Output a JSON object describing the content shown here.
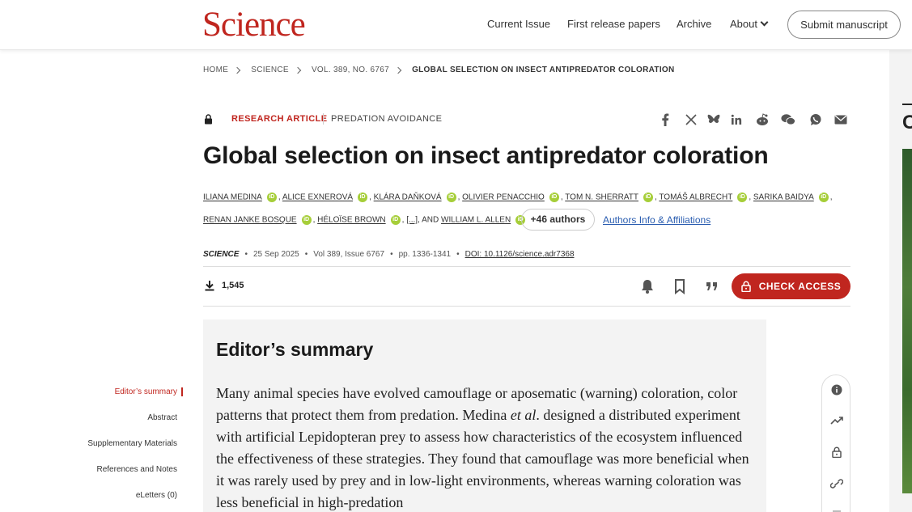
{
  "header": {
    "logo": "Science",
    "nav": {
      "current_issue": "Current Issue",
      "first_release": "First release papers",
      "archive": "Archive",
      "about": "About"
    },
    "submit_label": "Submit manuscript"
  },
  "breadcrumb": [
    "HOME",
    "SCIENCE",
    "VOL. 389, NO. 6767",
    "GLOBAL SELECTION ON INSECT ANTIPREDATOR COLORATION"
  ],
  "article": {
    "type": "RESEARCH ARTICLE",
    "subject": "PREDATION AVOIDANCE",
    "title": "Global selection on insect antipredator coloration",
    "authors_line1": [
      "ILIANA MEDINA",
      "ALICE EXNEROVÁ",
      "KLÁRA DAŇKOVÁ",
      "OLIVIER PENACCHIO",
      "TOM N. SHERRATT",
      "TOMÁŠ ALBRECHT",
      "SARIKA BAIDYA"
    ],
    "authors_line2": [
      "RENAN JANKE BOSQUE",
      "HÉLOÏSE BROWN"
    ],
    "ellipsis": "[...]",
    "and_label": "AND",
    "last_author": "WILLIAM L. ALLEN",
    "more_authors": "+46 authors",
    "affiliations_link": "Authors Info & Affiliations",
    "journal": "SCIENCE",
    "date": "25 Sep 2025",
    "volume": "Vol 389, Issue 6767",
    "pages": "pp. 1336-1341",
    "doi": "DOI: 10.1126/science.adr7368",
    "downloads": "1,545",
    "check_access": "CHECK ACCESS"
  },
  "summary": {
    "heading": "Editor’s summary",
    "text_before": "Many animal species have evolved camouflage or aposematic (warning) coloration, color patterns that protect them from predation. Medina ",
    "text_italic": "et al",
    "text_after": ". designed a distrib­uted experiment with artificial Lepidopteran prey to assess how characteristics of the ecosystem influenced the effectiveness of these strategies. They found that camouflage was more beneficial when it was rarely used by prey and in low-light environments, whereas warning coloration was less beneficial in high-predation"
  },
  "section_nav": [
    "Editor’s summary",
    "Abstract",
    "Supplementary Materials",
    "References and Notes",
    "eLetters (0)"
  ],
  "rail": {
    "letter": "C"
  },
  "colors": {
    "brand": "#c0261f",
    "link": "#2a5db0",
    "orcid": "#a6ce39"
  }
}
